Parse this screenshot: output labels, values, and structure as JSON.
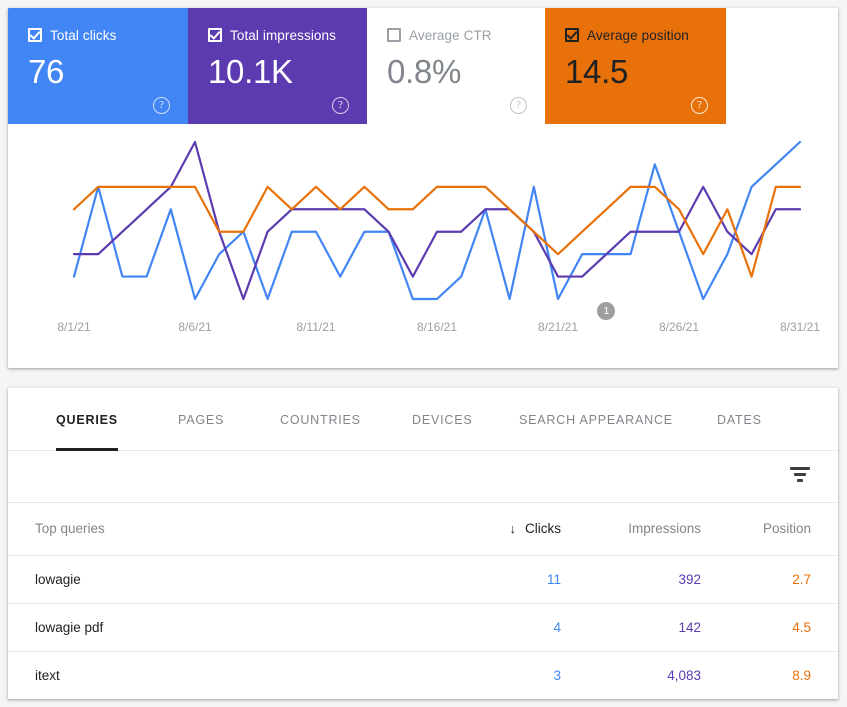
{
  "metrics": [
    {
      "id": "total-clicks",
      "label": "Total clicks",
      "value": "76",
      "checked": true,
      "color": "#4285f4",
      "help": "?"
    },
    {
      "id": "total-impressions",
      "label": "Total impressions",
      "value": "10.1K",
      "checked": true,
      "color": "#5c3bb0",
      "help": "?"
    },
    {
      "id": "average-ctr",
      "label": "Average CTR",
      "value": "0.8%",
      "checked": false,
      "color": "#ffffff",
      "help": "?"
    },
    {
      "id": "average-position",
      "label": "Average position",
      "value": "14.5",
      "checked": true,
      "color": "#e8710a",
      "help": "?"
    }
  ],
  "chart_data": {
    "type": "line",
    "title": "",
    "xlabel": "",
    "ylabel": "",
    "grid": false,
    "legend": "none",
    "x": [
      "8/1/21",
      "8/2/21",
      "8/3/21",
      "8/4/21",
      "8/5/21",
      "8/6/21",
      "8/7/21",
      "8/8/21",
      "8/9/21",
      "8/10/21",
      "8/11/21",
      "8/12/21",
      "8/13/21",
      "8/14/21",
      "8/15/21",
      "8/16/21",
      "8/17/21",
      "8/18/21",
      "8/19/21",
      "8/20/21",
      "8/21/21",
      "8/22/21",
      "8/23/21",
      "8/24/21",
      "8/25/21",
      "8/26/21",
      "8/27/21",
      "8/28/21",
      "8/29/21",
      "8/30/21",
      "8/31/21"
    ],
    "tick_labels": [
      "8/1/21",
      "8/6/21",
      "8/11/21",
      "8/16/21",
      "8/21/21",
      "8/26/21",
      "8/31/21"
    ],
    "tick_indices": [
      0,
      5,
      10,
      15,
      20,
      25,
      30
    ],
    "series": [
      {
        "name": "Total clicks",
        "color": "#4285f4",
        "values": [
          1,
          5,
          1,
          1,
          4,
          0,
          2,
          3,
          0,
          3,
          3,
          1,
          3,
          3,
          0,
          0,
          1,
          4,
          0,
          5,
          0,
          2,
          2,
          2,
          6,
          3,
          0,
          2,
          5,
          6,
          7
        ]
      },
      {
        "name": "Total impressions",
        "color": "#5c3bb0",
        "values": [
          2,
          2,
          3,
          4,
          5,
          7,
          3,
          0,
          3,
          4,
          4,
          4,
          4,
          3,
          1,
          3,
          3,
          4,
          4,
          3,
          1,
          1,
          2,
          3,
          3,
          3,
          5,
          3,
          2,
          4,
          4
        ]
      },
      {
        "name": "Average position",
        "color": "#e8710a",
        "values": [
          4,
          5,
          5,
          5,
          5,
          5,
          3,
          3,
          5,
          4,
          5,
          4,
          5,
          4,
          4,
          5,
          5,
          5,
          4,
          3,
          2,
          3,
          4,
          5,
          5,
          4,
          2,
          4,
          1,
          5,
          5
        ]
      }
    ],
    "annotations": [
      {
        "label": "1",
        "x_index": 22
      }
    ]
  },
  "table": {
    "tabs": [
      {
        "id": "queries",
        "label": "QUERIES",
        "active": true
      },
      {
        "id": "pages",
        "label": "PAGES",
        "active": false
      },
      {
        "id": "countries",
        "label": "COUNTRIES",
        "active": false
      },
      {
        "id": "devices",
        "label": "DEVICES",
        "active": false
      },
      {
        "id": "search-appearance",
        "label": "SEARCH APPEARANCE",
        "active": false
      },
      {
        "id": "dates",
        "label": "DATES",
        "active": false
      }
    ],
    "filter_icon": "filter-icon",
    "columns": {
      "query": "Top queries",
      "clicks": "Clicks",
      "impressions": "Impressions",
      "position": "Position",
      "sort_arrow": "↓"
    },
    "rows": [
      {
        "query": "lowagie",
        "clicks": "11",
        "impressions": "392",
        "position": "2.7"
      },
      {
        "query": "lowagie pdf",
        "clicks": "4",
        "impressions": "142",
        "position": "4.5"
      },
      {
        "query": "itext",
        "clicks": "3",
        "impressions": "4,083",
        "position": "8.9"
      }
    ]
  }
}
